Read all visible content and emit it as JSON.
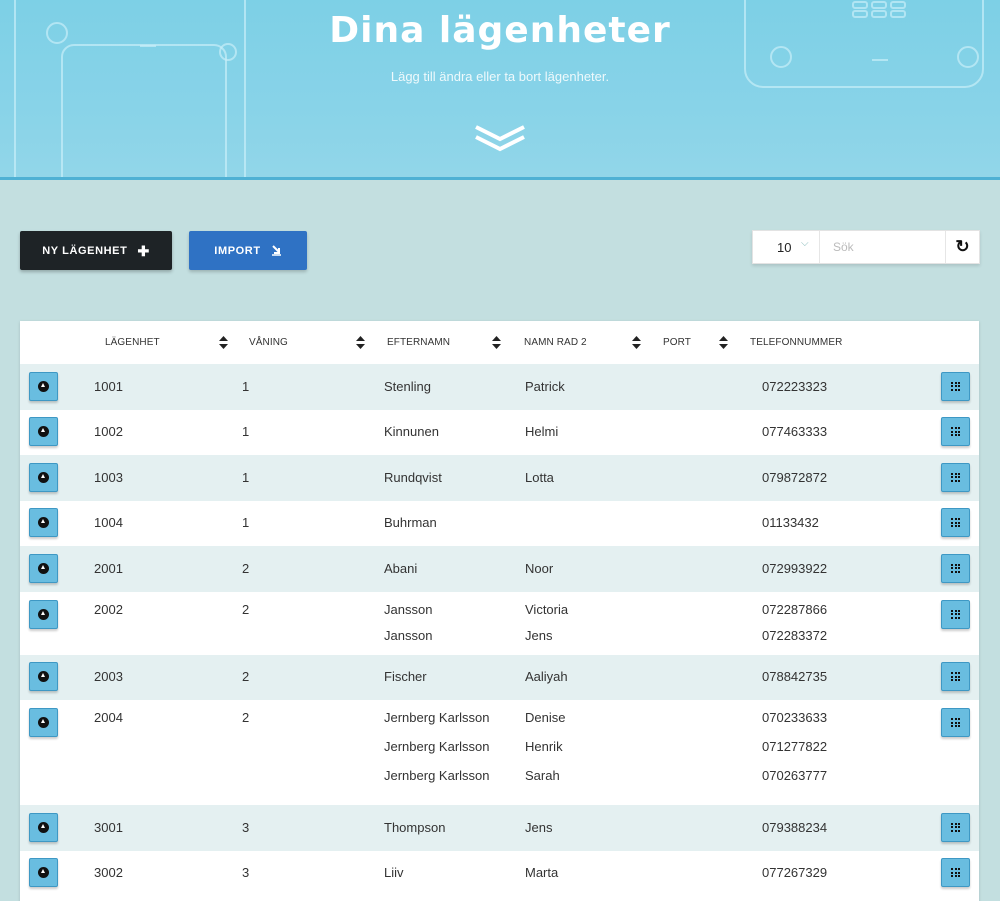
{
  "hero": {
    "title": "Dina lägenheter",
    "subtitle": "Lägg till ändra eller ta bort lägenheter."
  },
  "toolbar": {
    "new_label": "NY LÄGENHET",
    "new_icon": "plus-icon",
    "import_label": "IMPORT",
    "import_icon": "import-icon",
    "page_size": "10",
    "search_placeholder": "Sök",
    "search_value": "",
    "refresh_icon": "refresh-icon"
  },
  "table": {
    "columns": [
      "LÄGENHET",
      "VÅNING",
      "EFTERNAMN",
      "NAMN RAD 2",
      "PORT",
      "TELEFONNUMMER"
    ],
    "rows": [
      {
        "apt": "1001",
        "floor": "1",
        "residents": [
          {
            "last": "Stenling",
            "first": "Patrick",
            "phone": "072223323"
          }
        ]
      },
      {
        "apt": "1002",
        "floor": "1",
        "residents": [
          {
            "last": "Kinnunen",
            "first": "Helmi",
            "phone": "077463333"
          }
        ]
      },
      {
        "apt": "1003",
        "floor": "1",
        "residents": [
          {
            "last": "Rundqvist",
            "first": "Lotta",
            "phone": "079872872"
          }
        ]
      },
      {
        "apt": "1004",
        "floor": "1",
        "residents": [
          {
            "last": "Buhrman",
            "first": "",
            "phone": "01133432"
          }
        ]
      },
      {
        "apt": "2001",
        "floor": "2",
        "residents": [
          {
            "last": "Abani",
            "first": "Noor",
            "phone": "072993922"
          }
        ]
      },
      {
        "apt": "2002",
        "floor": "2",
        "residents": [
          {
            "last": "Jansson",
            "first": "Victoria",
            "phone": "072287866"
          },
          {
            "last": "Jansson",
            "first": "Jens",
            "phone": "072283372"
          }
        ]
      },
      {
        "apt": "2003",
        "floor": "2",
        "residents": [
          {
            "last": "Fischer",
            "first": "Aaliyah",
            "phone": "078842735"
          }
        ]
      },
      {
        "apt": "2004",
        "floor": "2",
        "residents": [
          {
            "last": "Jernberg Karlsson",
            "first": "Denise",
            "phone": "070233633"
          },
          {
            "last": "Jernberg Karlsson",
            "first": "Henrik",
            "phone": "071277822"
          },
          {
            "last": "Jernberg Karlsson",
            "first": "Sarah",
            "phone": "070263777"
          }
        ]
      },
      {
        "apt": "3001",
        "floor": "3",
        "residents": [
          {
            "last": "Thompson",
            "first": "Jens",
            "phone": "079388234"
          }
        ]
      },
      {
        "apt": "3002",
        "floor": "3",
        "residents": [
          {
            "last": "Liiv",
            "first": "Marta",
            "phone": "077267329"
          }
        ]
      }
    ]
  },
  "colors": {
    "hero_bg": "#88d3e8",
    "page_bg": "#c3dfe0",
    "primary_dark": "#1e2326",
    "import_blue": "#2f72c4",
    "row_shade": "#e4f0f1",
    "action_button": "#69bde0"
  }
}
